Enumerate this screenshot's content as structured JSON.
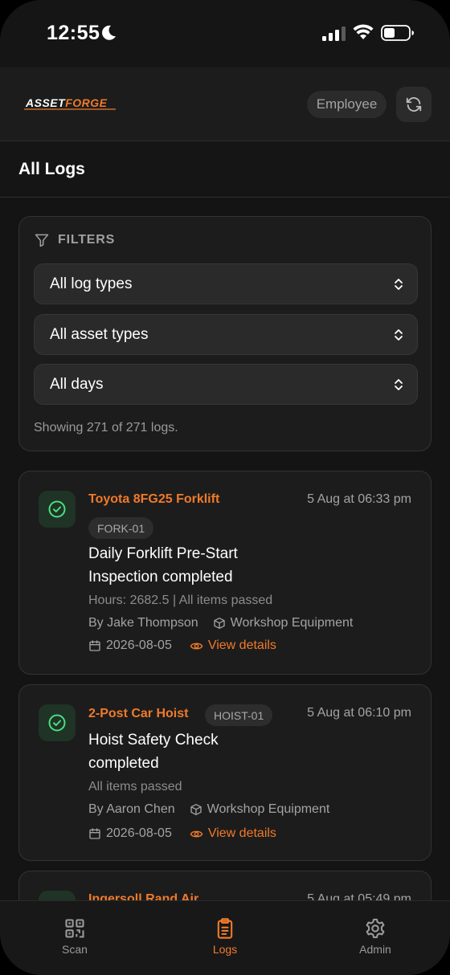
{
  "status_bar": {
    "time": "12:55"
  },
  "header": {
    "logo_text": "ASSETFORGE",
    "role": "Employee"
  },
  "page": {
    "title": "All Logs"
  },
  "filters": {
    "label": "FILTERS",
    "log_type": "All log types",
    "asset_type": "All asset types",
    "days": "All days",
    "showing": "Showing 271 of 271 logs."
  },
  "logs": [
    {
      "asset": "Toyota 8FG25 Forklift",
      "tag": "FORK-01",
      "time": "5 Aug at 06:33 pm",
      "title": "Daily Forklift Pre-Start Inspection completed",
      "detail": "Hours: 2682.5 | All items passed",
      "by": "By Jake Thompson",
      "category": "Workshop Equipment",
      "date": "2026-08-05",
      "view": "View details"
    },
    {
      "asset": "2-Post Car Hoist",
      "tag": "HOIST-01",
      "time": "5 Aug at 06:10 pm",
      "title": "Hoist Safety Check completed",
      "detail": "All items passed",
      "by": "By Aaron Chen",
      "category": "Workshop Equipment",
      "date": "2026-08-05",
      "view": "View details"
    },
    {
      "asset": "Ingersoll Rand Air",
      "time": "5 Aug at 05:49 pm"
    }
  ],
  "nav": {
    "scan": "Scan",
    "logs": "Logs",
    "admin": "Admin"
  },
  "colors": {
    "accent": "#f07a2a",
    "success": "#4ade80",
    "background": "#141414"
  }
}
